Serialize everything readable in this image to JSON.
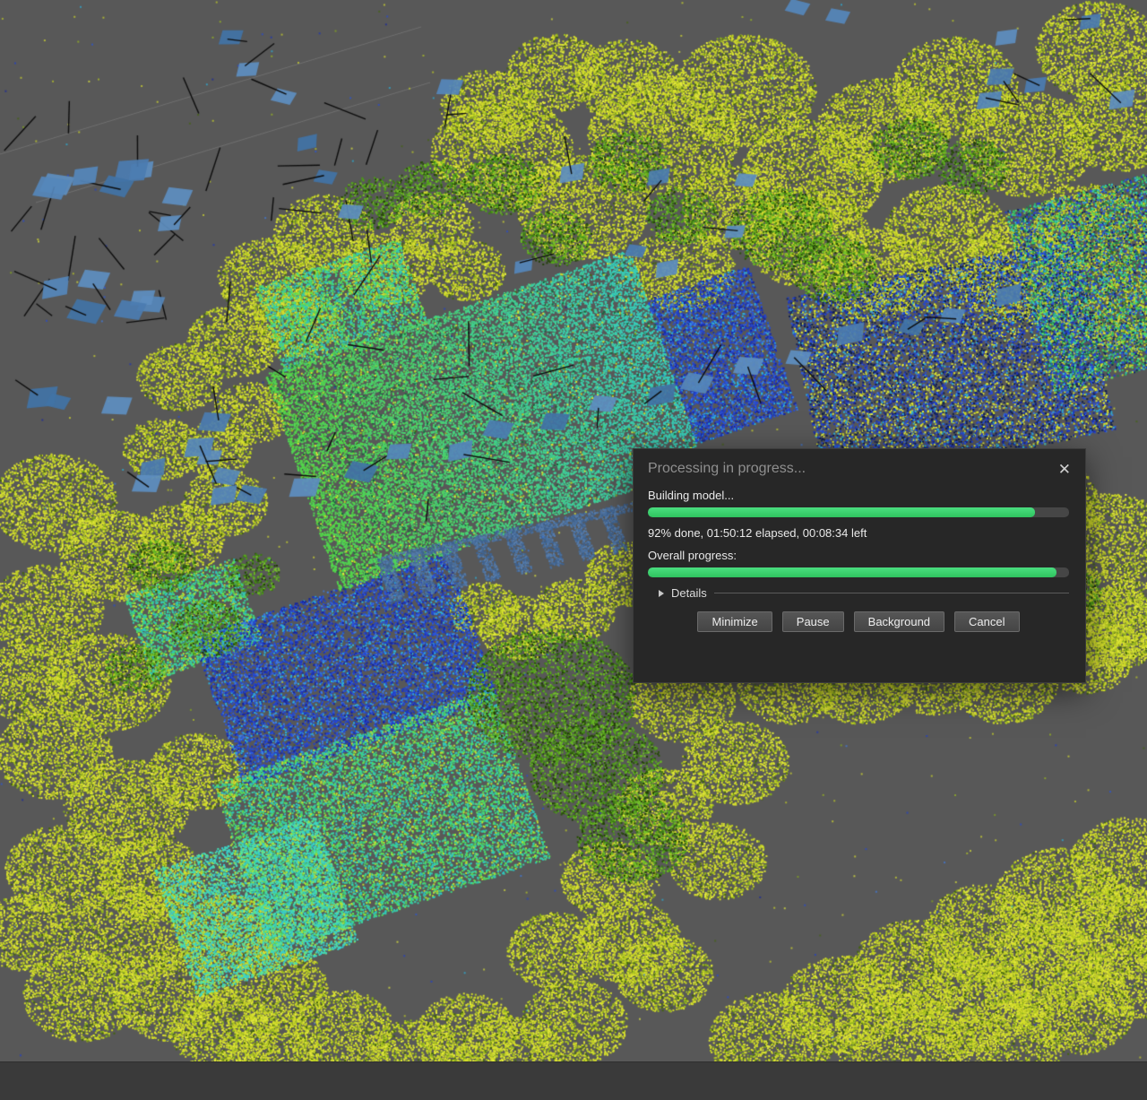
{
  "dialog": {
    "title": "Processing in progress...",
    "close_icon": "✕",
    "task_label": "Building model...",
    "task_progress_percent": 92,
    "status_text": "92% done, 01:50:12 elapsed, 00:08:34 left",
    "overall_label": "Overall progress:",
    "overall_progress_percent": 97,
    "details_label": "Details",
    "buttons": [
      {
        "label": "Minimize"
      },
      {
        "label": "Pause"
      },
      {
        "label": "Background"
      },
      {
        "label": "Cancel"
      }
    ],
    "accent_color": "#3ed06c"
  },
  "scene": {
    "background_color": "#585858",
    "bottom_bar_color": "#3a3a3a",
    "palette": {
      "vegetation": [
        "#d8e02e",
        "#cdd828",
        "#e4ec3c",
        "#c2ce24",
        "#b7cb22",
        "#dce438",
        "#9dbd1e",
        "#d2da2c",
        "#45650f",
        "#d8e02e",
        "#cdd828",
        "#87ad19"
      ],
      "tree": [
        "#59a81e",
        "#4c9a18",
        "#6ab824",
        "#3c7d12",
        "#2c520c",
        "#78c42c",
        "#223f08"
      ],
      "water_blue": [
        "#2140cc",
        "#1b33bb",
        "#2a55dd",
        "#3e7ce2",
        "#1726a0",
        "#2bb0dc",
        "#274ad4"
      ],
      "field_green": [
        "#3fd284",
        "#38c9a8",
        "#52dc5e",
        "#2fc3c3",
        "#62e04e",
        "#bfdc30",
        "#35cfae"
      ],
      "field_cyan": [
        "#45ddb2",
        "#3ed4c4",
        "#58e49a",
        "#36c9d2",
        "#aade3c"
      ],
      "pillar": [
        "#4a709f",
        "#3f6390",
        "#567cab"
      ],
      "camera_marker": [
        "#4b7cb0",
        "#5586ba",
        "#4273a6",
        "#5e8ec0"
      ]
    }
  }
}
